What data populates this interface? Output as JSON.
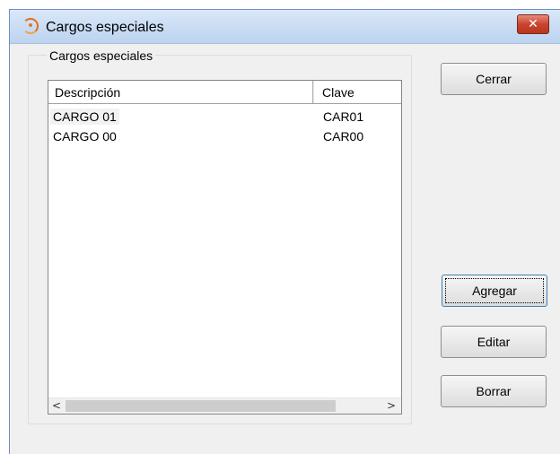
{
  "window": {
    "title": "Cargos especiales",
    "close_glyph": "✕"
  },
  "group": {
    "title": "Cargos especiales"
  },
  "list": {
    "columns": [
      "Descripción",
      "Clave"
    ],
    "rows": [
      {
        "descripcion": "CARGO 01",
        "clave": "CAR01"
      },
      {
        "descripcion": "CARGO 00",
        "clave": "CAR00"
      }
    ],
    "scroll_left": "<",
    "scroll_right": ">"
  },
  "buttons": {
    "cerrar": "Cerrar",
    "agregar": "Agregar",
    "editar": "Editar",
    "borrar": "Borrar"
  },
  "colors": {
    "title_gradient": "#c9dcf3",
    "close_red": "#c8452f",
    "window_bg": "#f0f0f0"
  },
  "icons": {
    "app": "app-logo-icon",
    "close": "close-icon",
    "scroll_left": "chevron-left-icon",
    "scroll_right": "chevron-right-icon"
  }
}
